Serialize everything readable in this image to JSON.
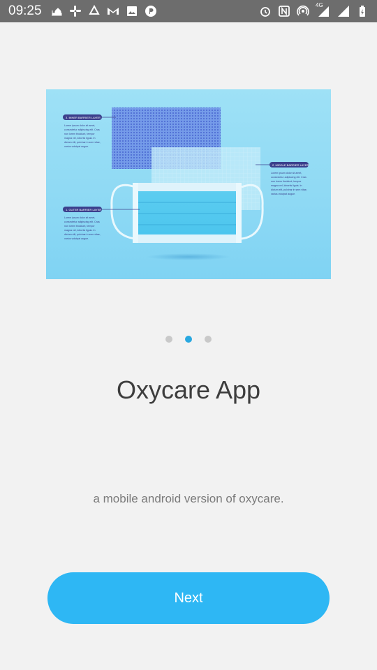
{
  "status_bar": {
    "time": "09:25",
    "left_icons": [
      "mosque-icon",
      "slack-icon",
      "recycle-icon",
      "gmail-icon",
      "image-icon",
      "p-app-icon"
    ],
    "right_icons": [
      "alarm-icon",
      "nfc-icon",
      "hotspot-icon",
      "signal-4g-icon",
      "signal-icon",
      "battery-icon"
    ],
    "network_label": "4G"
  },
  "hero": {
    "labels": {
      "inner": "3. INNER BARRIER LAYER",
      "middle": "2. MIDDLE BARRIER LAYER",
      "outer": "1. OUTER BARRIER LAYER"
    },
    "body_text": [
      "Lorem ipsum dolor sit amet,",
      "consectetur adipiscing elit. Cras",
      "non lorem tincidunt, tempor",
      "magna vel, lobortis ligula. In",
      "dictum elit, pulvinar in sem vitae,",
      "varius volutpat augue."
    ]
  },
  "pager": {
    "count": 3,
    "active": 1
  },
  "title": "Oxycare App",
  "subtitle": "a mobile android version of oxycare.",
  "next_label": "Next"
}
